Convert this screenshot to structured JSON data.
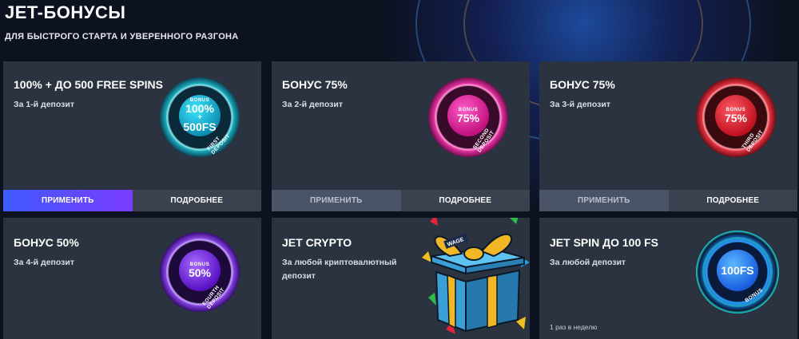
{
  "header": {
    "title": "JET-БОНУСЫ",
    "subtitle": "ДЛЯ БЫСТРОГО СТАРТА И УВЕРЕННОГО РАЗГОНА"
  },
  "cards": [
    {
      "title": "100% + ДО 500 FREE SPINS",
      "desc": "За 1-й депозит",
      "badge": {
        "caption": "BONUS",
        "line1": "100%",
        "line2": "+",
        "line3": "500FS",
        "ribbon": "FIRST DEPOSIT",
        "color": "#22c9d6"
      },
      "apply_label": "ПРИМЕНИТЬ",
      "more_label": "ПОДРОБНЕЕ"
    },
    {
      "title": "БОНУС 75%",
      "desc": "За 2-й депозит",
      "badge": {
        "caption": "BONUS",
        "value": "75%",
        "ribbon": "SECOND DEPOSIT",
        "color": "#e61e9a"
      },
      "apply_label": "ПРИМЕНИТЬ",
      "more_label": "ПОДРОБНЕЕ"
    },
    {
      "title": "БОНУС 75%",
      "desc": "За 3-й депозит",
      "badge": {
        "caption": "BONUS",
        "value": "75%",
        "ribbon": "THIRD DEPOSIT",
        "color": "#e0202d"
      },
      "apply_label": "ПРИМЕНИТЬ",
      "more_label": "ПОДРОБНЕЕ"
    },
    {
      "title": "БОНУС 50%",
      "desc": "За 4-й депозит",
      "badge": {
        "caption": "BONUS",
        "value": "50%",
        "ribbon": "FOURTH DEPOSIT",
        "color": "#7a2cff"
      }
    },
    {
      "title": "JET CRYPTO",
      "desc_line1": "За любой криптовалютный",
      "desc_line2": "депозит",
      "gift_ribbon": "WAGE",
      "icon": "gift-box-icon"
    },
    {
      "title": "JET SPIN ДО 100 FS",
      "desc": "За любой депозит",
      "note": "1 раз в неделю",
      "badge": {
        "value": "100FS",
        "ribbon": "BONUS",
        "color": "#1a7cff"
      }
    }
  ],
  "colors": {
    "background": "#0d1220",
    "card": "#2b3340",
    "apply_active_from": "#3f5bff",
    "apply_active_to": "#7a3dff"
  }
}
